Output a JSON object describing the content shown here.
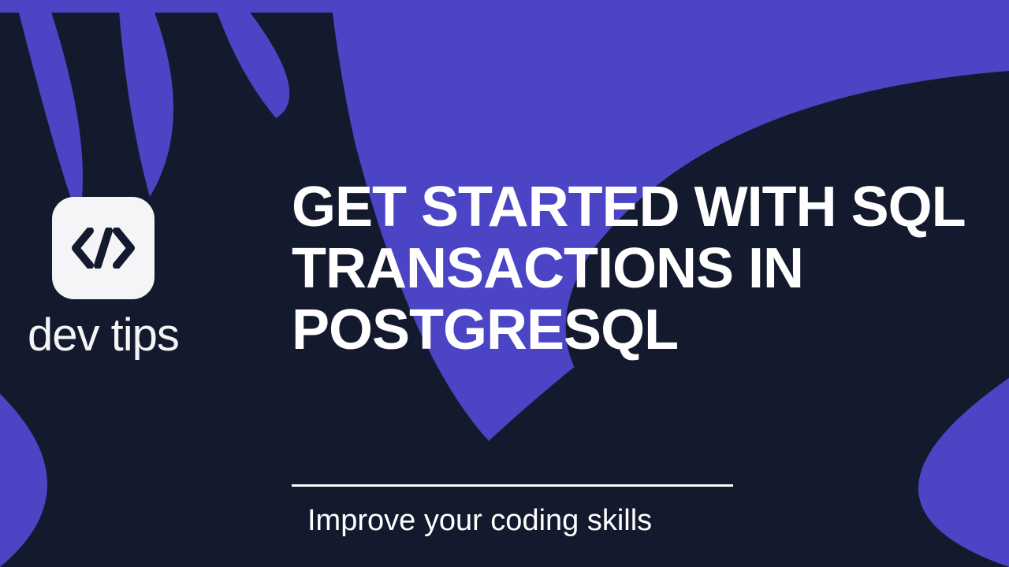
{
  "brand": {
    "icon_name": "code-brackets-icon",
    "name": "dev tips"
  },
  "title": "GET STARTED WITH SQL TRANSACTIONS IN POSTGRESQL",
  "subtitle": "Improve your coding skills",
  "colors": {
    "background": "#141a2e",
    "accent": "#4b45c6",
    "text": "#ffffff",
    "logo_bg": "#f5f5f7"
  }
}
